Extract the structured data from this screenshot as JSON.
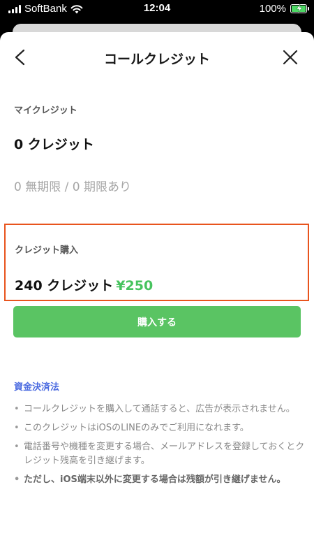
{
  "status_bar": {
    "carrier": "SoftBank",
    "time": "12:04",
    "battery": "100%"
  },
  "nav": {
    "title": "コールクレジット"
  },
  "my_credit": {
    "label": "マイクレジット",
    "value": "0 クレジット",
    "detail": "0 無期限 / 0 期限あり"
  },
  "purchase": {
    "label": "クレジット購入",
    "amount": "240 クレジット",
    "price": "¥250",
    "button": "購入する"
  },
  "funds_link": "資金決済法",
  "notes": [
    "コールクレジットを購入して通話すると、広告が表示されません。",
    "このクレジットはiOSのLINEのみでご利用になれます。",
    "電話番号や機種を変更する場合、メールアドレスを登録しておくとクレジット残高を引き継げます。",
    "ただし、iOS端末以外に変更する場合は残額が引き継げません。"
  ]
}
